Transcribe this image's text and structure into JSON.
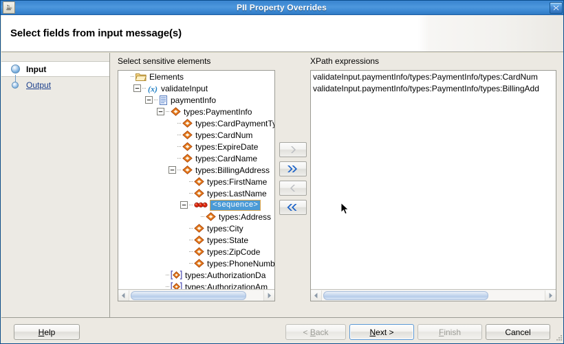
{
  "window": {
    "title": "PII Property Overrides",
    "app_icon": "java-coffee-cup-icon",
    "close_icon": "close-icon"
  },
  "banner": {
    "title": "Select fields from input message(s)"
  },
  "sidebar": {
    "steps": [
      {
        "label": "Input",
        "selected": true
      },
      {
        "label": "Output",
        "selected": false
      }
    ]
  },
  "panes": {
    "tree_label": "Select sensitive elements",
    "xpath_label": "XPath expressions"
  },
  "tree": {
    "nodes": [
      {
        "label": "Elements",
        "indent": 0,
        "icon": "folder-open-icon",
        "toggle": "none",
        "selected": false
      },
      {
        "label": "validateInput",
        "indent": 1,
        "icon": "variable-x-icon",
        "toggle": "minus",
        "selected": false
      },
      {
        "label": "paymentInfo",
        "indent": 2,
        "icon": "message-doc-icon",
        "toggle": "minus",
        "selected": false
      },
      {
        "label": "types:PaymentInfo",
        "indent": 3,
        "icon": "element-icon",
        "toggle": "minus",
        "selected": false
      },
      {
        "label": "types:CardPaymentTy",
        "indent": 4,
        "icon": "element-icon",
        "toggle": "none",
        "selected": false
      },
      {
        "label": "types:CardNum",
        "indent": 4,
        "icon": "element-icon",
        "toggle": "none",
        "selected": false
      },
      {
        "label": "types:ExpireDate",
        "indent": 4,
        "icon": "element-icon",
        "toggle": "none",
        "selected": false
      },
      {
        "label": "types:CardName",
        "indent": 4,
        "icon": "element-icon",
        "toggle": "none",
        "selected": false
      },
      {
        "label": "types:BillingAddress",
        "indent": 4,
        "icon": "element-icon",
        "toggle": "minus",
        "selected": false
      },
      {
        "label": "types:FirstName",
        "indent": 5,
        "icon": "element-icon",
        "toggle": "none",
        "selected": false
      },
      {
        "label": "types:LastName",
        "indent": 5,
        "icon": "element-icon",
        "toggle": "none",
        "selected": false
      },
      {
        "label": "<sequence>",
        "indent": 5,
        "icon": "sequence-dots-icon",
        "toggle": "minus",
        "selected": true
      },
      {
        "label": "types:Address",
        "indent": 6,
        "icon": "element-icon",
        "toggle": "none",
        "selected": false
      },
      {
        "label": "types:City",
        "indent": 5,
        "icon": "element-icon",
        "toggle": "none",
        "selected": false
      },
      {
        "label": "types:State",
        "indent": 5,
        "icon": "element-icon",
        "toggle": "none",
        "selected": false
      },
      {
        "label": "types:ZipCode",
        "indent": 5,
        "icon": "element-icon",
        "toggle": "none",
        "selected": false
      },
      {
        "label": "types:PhoneNumb",
        "indent": 5,
        "icon": "element-icon",
        "toggle": "none",
        "selected": false
      },
      {
        "label": "types:AuthorizationDa",
        "indent": 3,
        "icon": "attribute-icon",
        "toggle": "none",
        "selected": false
      },
      {
        "label": "types:AuthorizationAm",
        "indent": 3,
        "icon": "attribute-icon",
        "toggle": "none",
        "selected": false
      }
    ]
  },
  "xpath": {
    "expressions": [
      "validateInput.paymentInfo/types:PaymentInfo/types:CardNum",
      "validateInput.paymentInfo/types:PaymentInfo/types:BillingAdd"
    ]
  },
  "transfer_buttons": [
    {
      "name": "add-one-button",
      "icon": "chevron-right-icon",
      "enabled": false
    },
    {
      "name": "add-all-button",
      "icon": "chevron-double-right-icon",
      "enabled": true
    },
    {
      "name": "remove-one-button",
      "icon": "chevron-left-icon",
      "enabled": false
    },
    {
      "name": "remove-all-button",
      "icon": "chevron-double-left-icon",
      "enabled": true
    }
  ],
  "footer": {
    "help": {
      "label": "Help",
      "mnemonic": "H",
      "enabled": true,
      "focused": false
    },
    "back": {
      "label": "< Back",
      "mnemonic": "B",
      "enabled": false,
      "focused": false
    },
    "next": {
      "label": "Next >",
      "mnemonic": "N",
      "enabled": true,
      "focused": true
    },
    "finish": {
      "label": "Finish",
      "mnemonic": "F",
      "enabled": false,
      "focused": false
    },
    "cancel": {
      "label": "Cancel",
      "mnemonic": "",
      "enabled": true,
      "focused": false
    }
  },
  "colors": {
    "titlebar_blue": "#4d97dd",
    "selection_blue": "#4a9ad6",
    "selection_border": "#e0a64a",
    "element_orange": "#f07e1e",
    "dialog_gray": "#ece9e2"
  }
}
